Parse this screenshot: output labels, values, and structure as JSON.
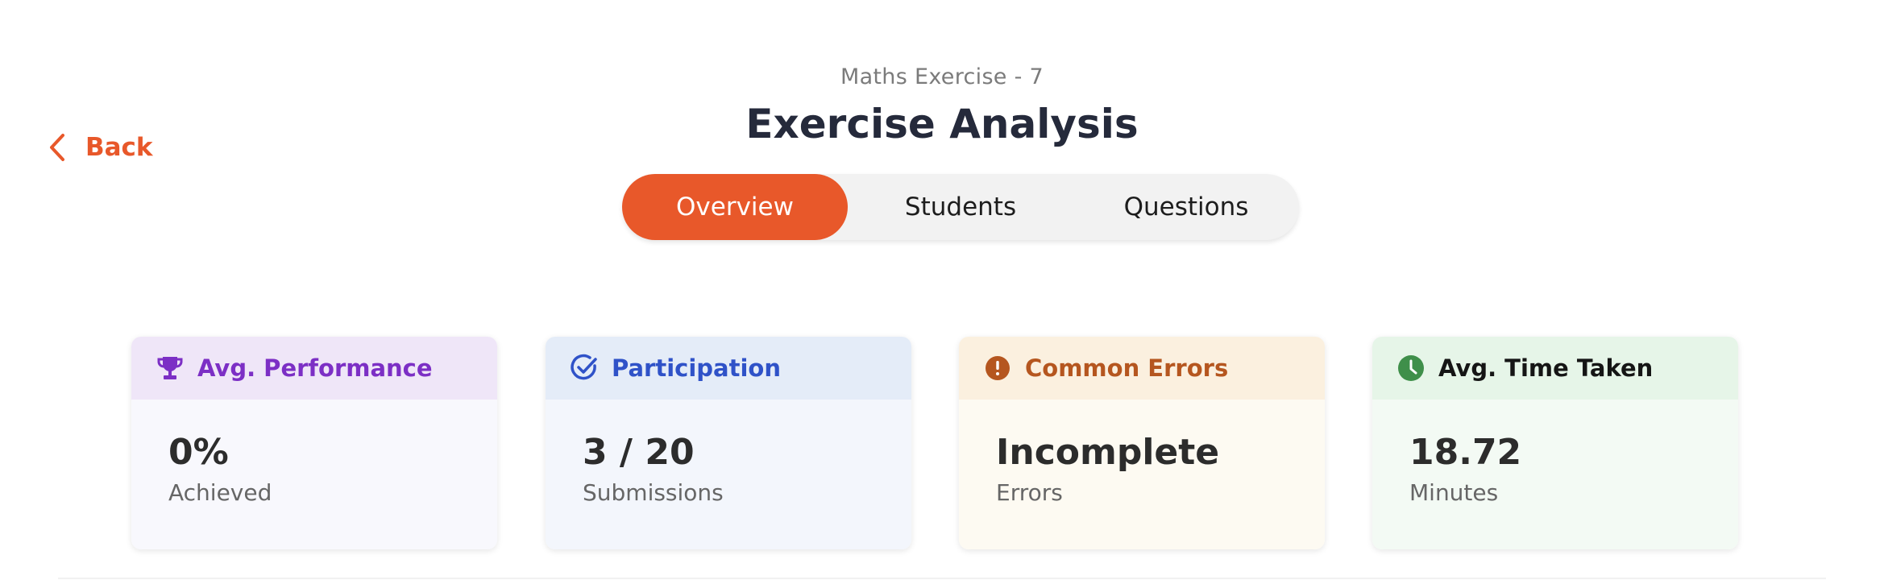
{
  "back": {
    "label": "Back",
    "icon": "chevron-left-icon"
  },
  "header": {
    "subtitle": "Maths Exercise - 7",
    "title": "Exercise Analysis"
  },
  "tabs": [
    {
      "label": "Overview",
      "active": true
    },
    {
      "label": "Students",
      "active": false
    },
    {
      "label": "Questions",
      "active": false
    }
  ],
  "cards": [
    {
      "title": "Avg. Performance",
      "icon": "trophy-icon",
      "value": "0%",
      "caption": "Achieved",
      "accent": "#7c2fc5"
    },
    {
      "title": "Participation",
      "icon": "check-circle-icon",
      "value": "3 / 20",
      "caption": "Submissions",
      "accent": "#2f52c8"
    },
    {
      "title": "Common Errors",
      "icon": "alert-circle-icon",
      "value": "Incomplete",
      "caption": "Errors",
      "accent": "#b5561f"
    },
    {
      "title": "Avg. Time Taken",
      "icon": "clock-icon",
      "value": "18.72",
      "caption": "Minutes",
      "accent": "#3f8f4a"
    }
  ],
  "colors": {
    "brand": "#e8582a"
  }
}
